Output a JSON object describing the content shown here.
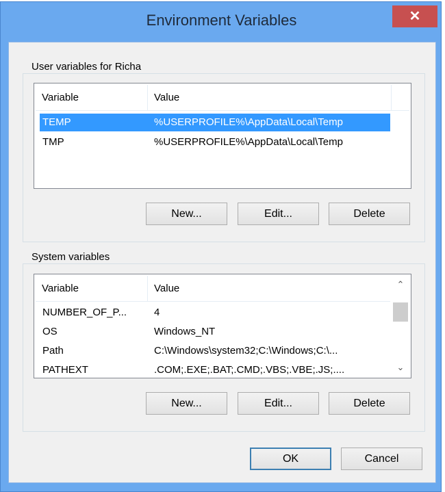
{
  "window": {
    "title": "Environment Variables",
    "close_label": "✕"
  },
  "user_vars": {
    "group_label": "User variables for Richa",
    "columns": [
      "Variable",
      "Value"
    ],
    "rows": [
      {
        "variable": "TEMP",
        "value": "%USERPROFILE%\\AppData\\Local\\Temp",
        "selected": true
      },
      {
        "variable": "TMP",
        "value": "%USERPROFILE%\\AppData\\Local\\Temp",
        "selected": false
      }
    ],
    "buttons": {
      "new": "New...",
      "edit": "Edit...",
      "delete": "Delete"
    }
  },
  "system_vars": {
    "group_label": "System variables",
    "columns": [
      "Variable",
      "Value"
    ],
    "rows": [
      {
        "variable": "NUMBER_OF_P...",
        "value": "4"
      },
      {
        "variable": "OS",
        "value": "Windows_NT"
      },
      {
        "variable": "Path",
        "value": "C:\\Windows\\system32;C:\\Windows;C:\\..."
      },
      {
        "variable": "PATHEXT",
        "value": ".COM;.EXE;.BAT;.CMD;.VBS;.VBE;.JS;...."
      }
    ],
    "scroll": {
      "up": "⌃",
      "down": "⌄"
    },
    "buttons": {
      "new": "New...",
      "edit": "Edit...",
      "delete": "Delete"
    }
  },
  "footer": {
    "ok": "OK",
    "cancel": "Cancel"
  }
}
